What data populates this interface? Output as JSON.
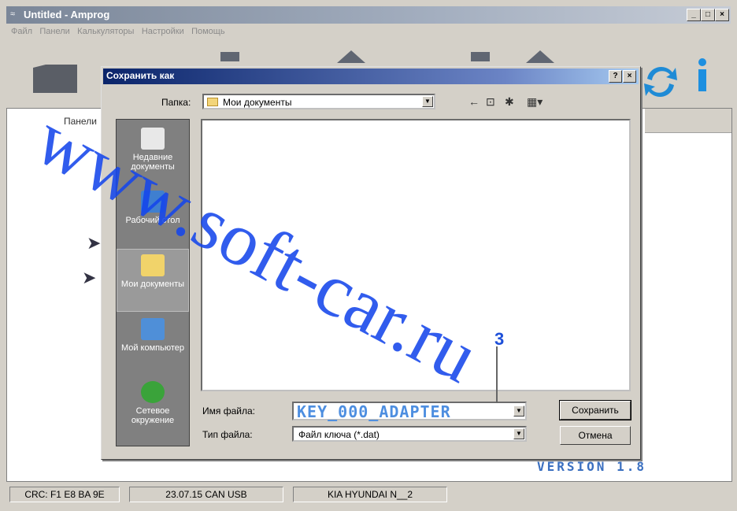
{
  "window": {
    "title": "Untitled - Amprog",
    "controls": [
      "_",
      "□",
      "×"
    ]
  },
  "menu": [
    "Файл",
    "Панели",
    "Калькуляторы",
    "Настройки",
    "Помощь"
  ],
  "main": {
    "panel_label": "Панели"
  },
  "dialog": {
    "title": "Сохранить как",
    "help_btn": "?",
    "close_btn": "×",
    "folder_label": "Папка:",
    "folder_value": "Мои документы",
    "places": [
      {
        "label": "Недавние документы",
        "icon": "recent-documents-icon"
      },
      {
        "label": "Рабочий стол",
        "icon": "desktop-icon"
      },
      {
        "label": "Мои документы",
        "icon": "my-documents-icon"
      },
      {
        "label": "Мой компьютер",
        "icon": "my-computer-icon"
      },
      {
        "label": "Сетевое окружение",
        "icon": "network-icon"
      }
    ],
    "filename_label": "Имя файла:",
    "filename_value": "KEY_000_ADAPTER",
    "filetype_label": "Тип файла:",
    "filetype_value": "Файл ключа (*.dat)",
    "save_label": "Сохранить",
    "cancel_label": "Отмена"
  },
  "statusbar": [
    "CRC: F1 E8 BA 9E",
    "23.07.15 CAN USB",
    "KIA HYUNDAI N__2"
  ],
  "overlay": {
    "watermark": "www.soft-car.ru",
    "version": "VERSION 1.8",
    "annotation": "3"
  },
  "colors": {
    "dialog_title_bg": "#0a246a",
    "watermark": "#1446eb",
    "filename_text": "#4d8ee0"
  }
}
